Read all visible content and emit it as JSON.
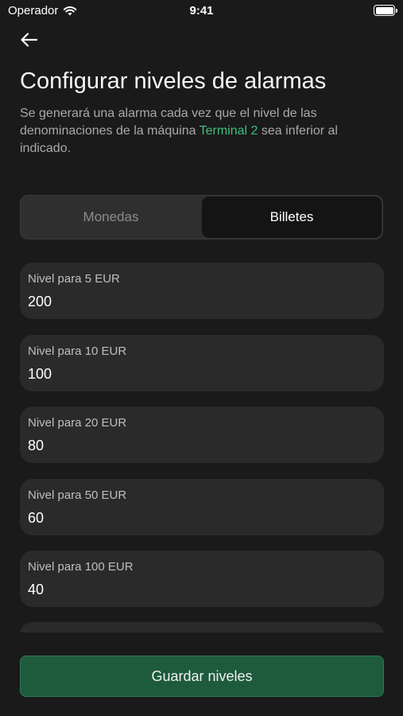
{
  "status_bar": {
    "carrier": "Operador",
    "time": "9:41"
  },
  "header": {
    "title": "Configurar niveles de alarmas",
    "description_before": "Se generará una alarma cada vez que el nivel de las denominaciones de la máquina ",
    "terminal_name": "Terminal 2",
    "description_after": " sea inferior al indicado."
  },
  "tabs": {
    "coins": "Monedas",
    "bills": "Billetes",
    "selected": "Billetes"
  },
  "levels": [
    {
      "label": "Nivel para 5 EUR",
      "value": "200"
    },
    {
      "label": "Nivel para 10 EUR",
      "value": "100"
    },
    {
      "label": "Nivel para 20 EUR",
      "value": "80"
    },
    {
      "label": "Nivel para 50 EUR",
      "value": "60"
    },
    {
      "label": "Nivel para 100 EUR",
      "value": "40"
    }
  ],
  "save_label": "Guardar niveles",
  "colors": {
    "accent": "#3fbf7f",
    "button": "#1d5b3c",
    "background": "#1a1a1a"
  }
}
